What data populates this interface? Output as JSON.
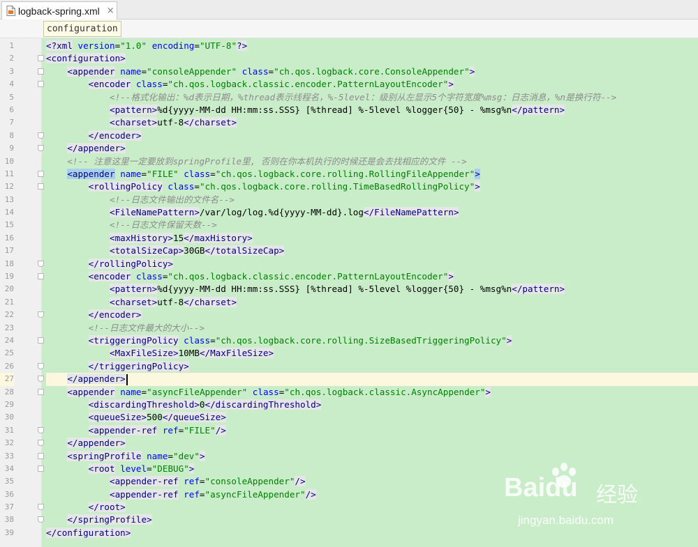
{
  "tab": {
    "title": "logback-spring.xml",
    "close_glyph": "×",
    "icon": "xml-file-icon"
  },
  "breadcrumb": {
    "label": "configuration"
  },
  "editor": {
    "current_line": 27,
    "selected_tag": "appender",
    "lines": [
      "<?xml version=\"1.0\" encoding=\"UTF-8\"?>",
      "<configuration>",
      "    <appender name=\"consoleAppender\" class=\"ch.qos.logback.core.ConsoleAppender\">",
      "        <encoder class=\"ch.qos.logback.classic.encoder.PatternLayoutEncoder\">",
      "            <!--格式化输出：%d表示日期，%thread表示线程名，%-5level：级别从左显示5个字符宽度%msg：日志消息，%n是换行符-->",
      "            <pattern>%d{yyyy-MM-dd HH:mm:ss.SSS} [%thread] %-5level %logger{50} - %msg%n</pattern>",
      "            <charset>utf-8</charset>",
      "        </encoder>",
      "    </appender>",
      "    <!-- 注意这里一定要放到springProfile里, 否则在你本机执行的时候还是会去找相应的文件 -->",
      "    <appender name=\"FILE\" class=\"ch.qos.logback.core.rolling.RollingFileAppender\">",
      "        <rollingPolicy class=\"ch.qos.logback.core.rolling.TimeBasedRollingPolicy\">",
      "            <!--日志文件输出的文件名-->",
      "            <FileNamePattern>/var/log/log.%d{yyyy-MM-dd}.log</FileNamePattern>",
      "            <!--日志文件保留天数-->",
      "            <maxHistory>15</maxHistory>",
      "            <totalSizeCap>30GB</totalSizeCap>",
      "        </rollingPolicy>",
      "        <encoder class=\"ch.qos.logback.classic.encoder.PatternLayoutEncoder\">",
      "            <pattern>%d{yyyy-MM-dd HH:mm:ss.SSS} [%thread] %-5level %logger{50} - %msg%n</pattern>",
      "            <charset>utf-8</charset>",
      "        </encoder>",
      "        <!--日志文件最大的大小-->",
      "        <triggeringPolicy class=\"ch.qos.logback.core.rolling.SizeBasedTriggeringPolicy\">",
      "            <MaxFileSize>10MB</MaxFileSize>",
      "        </triggeringPolicy>",
      "    </appender>",
      "    <appender name=\"asyncFileAppender\" class=\"ch.qos.logback.classic.AsyncAppender\">",
      "        <discardingThreshold>0</discardingThreshold>",
      "        <queueSize>500</queueSize>",
      "        <appender-ref ref=\"FILE\"/>",
      "    </appender>",
      "    <springProfile name=\"dev\">",
      "        <root level=\"DEBUG\">",
      "            <appender-ref ref=\"consoleAppender\"/>",
      "            <appender-ref ref=\"asyncFileAppender\"/>",
      "        </root>",
      "    </springProfile>",
      "</configuration>"
    ],
    "fold_start_lines": [
      2,
      3,
      4,
      11,
      12,
      19,
      24,
      28,
      33,
      34
    ],
    "fold_end_lines": [
      8,
      9,
      18,
      22,
      26,
      27,
      31,
      32,
      37,
      38
    ]
  },
  "watermark": {
    "logo_text": "Bai",
    "logo_text_2": "du",
    "brand": "经验",
    "url": "jingyan.baidu.com"
  },
  "colors": {
    "code_background": "#c9ecc9",
    "tag": "#000080",
    "attr_name": "#0000ff",
    "attr_value": "#008000",
    "comment": "#8c8c8c",
    "current_line": "#fcf8e0",
    "selection": "#aacfee"
  }
}
